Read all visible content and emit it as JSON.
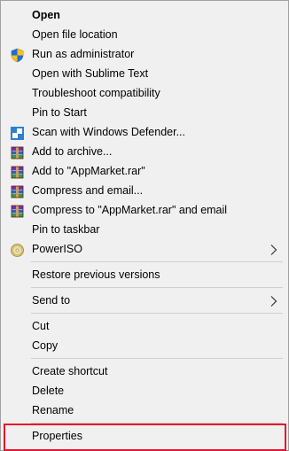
{
  "menu": {
    "items": [
      {
        "label": "Open"
      },
      {
        "label": "Open file location"
      },
      {
        "label": "Run as administrator",
        "icon": "uac-shield-icon"
      },
      {
        "label": "Open with Sublime Text"
      },
      {
        "label": "Troubleshoot compatibility"
      },
      {
        "label": "Pin to Start"
      },
      {
        "label": "Scan with Windows Defender...",
        "icon": "windows-defender-icon"
      },
      {
        "label": "Add to archive...",
        "icon": "winrar-icon"
      },
      {
        "label": "Add to \"AppMarket.rar\"",
        "icon": "winrar-icon"
      },
      {
        "label": "Compress and email...",
        "icon": "winrar-icon"
      },
      {
        "label": "Compress to \"AppMarket.rar\" and email",
        "icon": "winrar-icon"
      },
      {
        "label": "Pin to taskbar"
      },
      {
        "label": "PowerISO",
        "icon": "poweriso-disc-icon"
      },
      {
        "label": "Restore previous versions"
      },
      {
        "label": "Send to"
      },
      {
        "label": "Cut"
      },
      {
        "label": "Copy"
      },
      {
        "label": "Create shortcut"
      },
      {
        "label": "Delete"
      },
      {
        "label": "Rename"
      },
      {
        "label": "Properties"
      }
    ]
  },
  "colors": {
    "menu_background": "#f0f0f0",
    "separator": "#cfcfcf",
    "highlight_border": "#e2142d"
  }
}
